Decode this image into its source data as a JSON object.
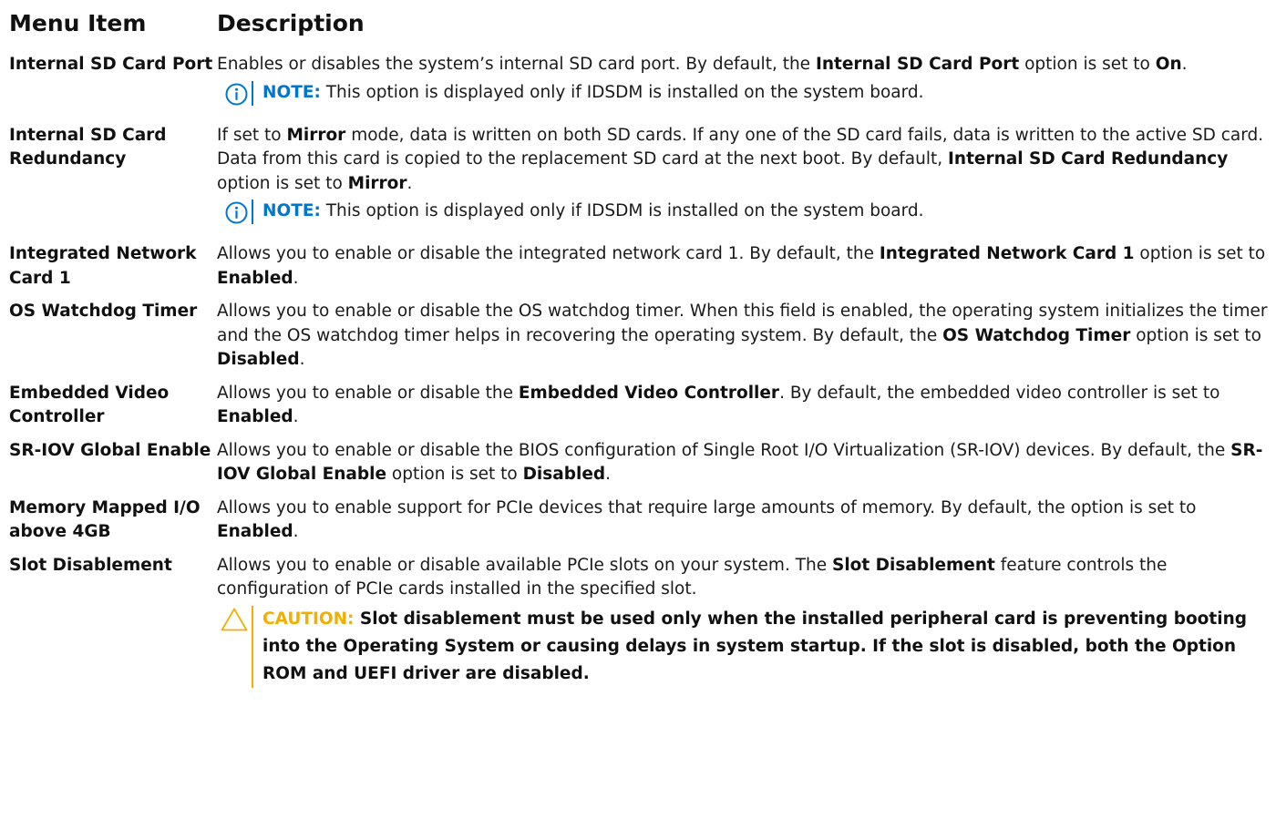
{
  "header": {
    "col1": "Menu Item",
    "col2": "Description"
  },
  "rows": [
    {
      "item": "Internal SD Card Port",
      "desc": [
        "Enables or disables the system’s internal SD card port. By default, the ",
        "Internal SD Card Port",
        " option is set to ",
        "On",
        "."
      ],
      "note_label": "NOTE:",
      "note_text": " This option is displayed only if IDSDM is installed on the system board."
    },
    {
      "item": "Internal SD Card Redundancy",
      "desc": [
        "If set to ",
        "Mirror",
        " mode, data is written on both SD cards. If any one of the SD card fails, data is written to the active SD card. Data from this card is copied to the replacement SD card at the next boot. By default, ",
        "Internal SD Card Redundancy",
        " option is set to ",
        "Mirror",
        "."
      ],
      "note_label": "NOTE:",
      "note_text": " This option is displayed only if IDSDM is installed on the system board."
    },
    {
      "item": "Integrated Network Card 1",
      "desc": [
        "Allows you to enable or disable the integrated network card 1. By default, the ",
        "Integrated Network Card 1",
        " option is set to ",
        "Enabled",
        "."
      ]
    },
    {
      "item": "OS Watchdog Timer",
      "desc": [
        "Allows you to enable or disable the OS watchdog timer. When this field is enabled, the operating system initializes the timer and the OS watchdog timer helps in recovering the operating system. By default, the ",
        "OS Watchdog Timer",
        " option is set to ",
        "Disabled",
        "."
      ]
    },
    {
      "item": "Embedded Video Controller",
      "desc": [
        "Allows you to enable or disable the ",
        "Embedded Video Controller",
        ". By default, the embedded video controller is set to ",
        "Enabled",
        "."
      ]
    },
    {
      "item": "SR-IOV Global Enable",
      "desc": [
        "Allows you to enable or disable the BIOS configuration of Single Root I/O Virtualization (SR-IOV) devices. By default, the ",
        "SR-IOV Global Enable",
        " option is set to ",
        "Disabled",
        "."
      ]
    },
    {
      "item": "Memory Mapped I/O above 4GB",
      "desc": [
        "Allows you to enable support for PCIe devices that require large amounts of memory. By default, the option is set to ",
        "Enabled",
        "."
      ]
    },
    {
      "item": "Slot Disablement",
      "desc": [
        "Allows you to enable or disable available PCIe slots on your system. The ",
        "Slot Disablement",
        " feature controls the configuration of PCIe cards installed in the specified slot."
      ],
      "caution_label": "CAUTION:",
      "caution_text": " Slot disablement must be used only when the installed peripheral card is preventing booting into the Operating System or causing delays in system startup. If the slot is disabled, both the Option ROM and UEFI driver are disabled."
    }
  ],
  "colors": {
    "note": "#0076ce",
    "caution": "#f2af00",
    "text": "#1a1a1a"
  },
  "icons": {
    "note": "info-icon",
    "caution": "warning-triangle-icon"
  }
}
